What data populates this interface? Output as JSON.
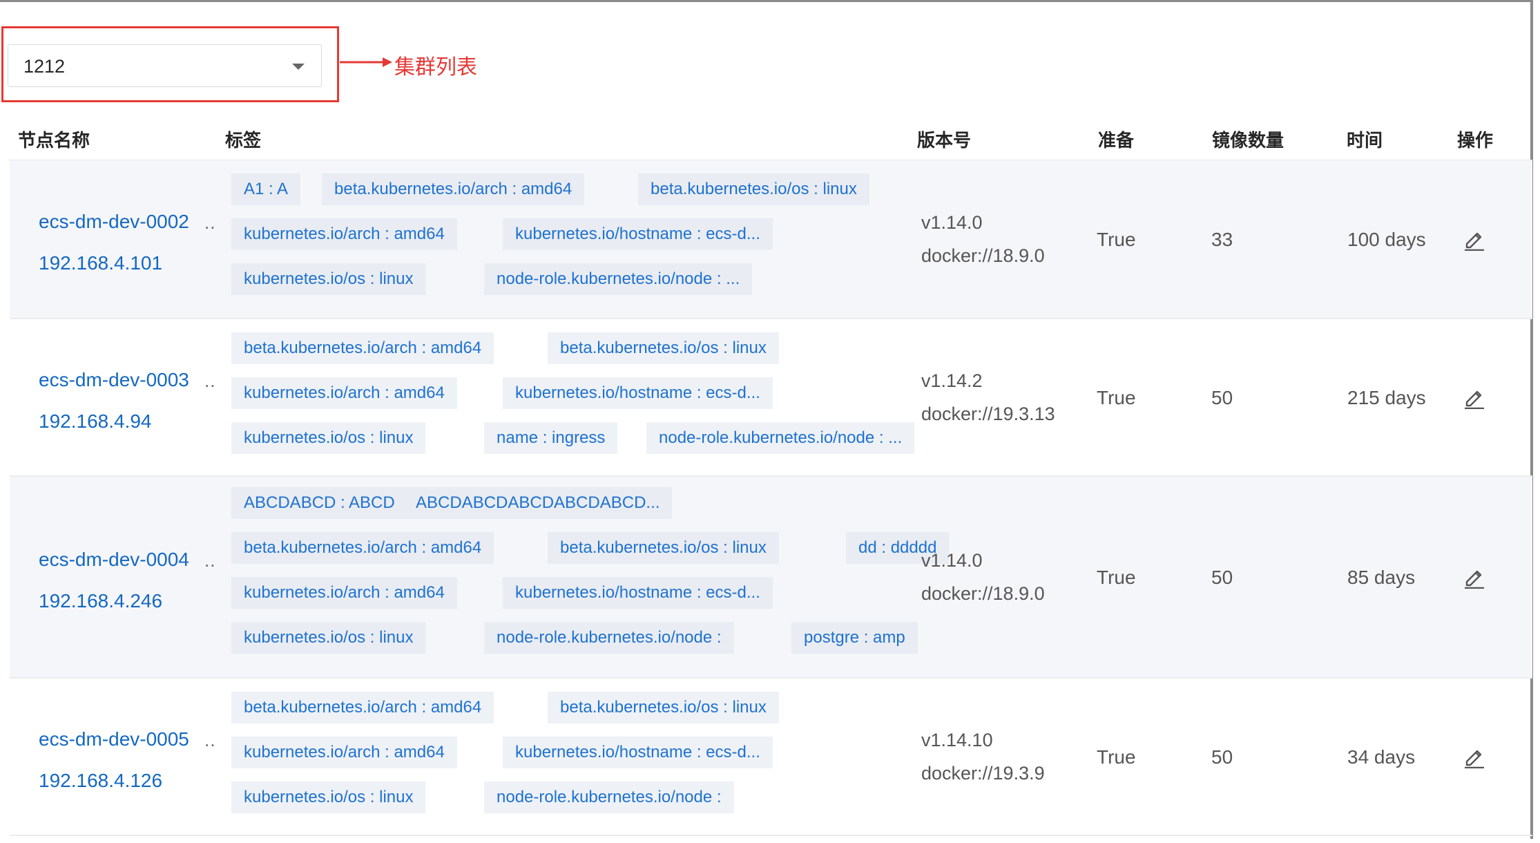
{
  "cluster_select": {
    "value": "1212"
  },
  "annotation": {
    "label": "集群列表"
  },
  "columns": [
    "节点名称",
    "标签",
    "版本号",
    "准备",
    "镜像数量",
    "时间",
    "操作"
  ],
  "rows": [
    {
      "name": "ecs-dm-dev-0002",
      "ip": "192.168.4.101",
      "dots": "..",
      "tags": [
        [
          "A1 : A",
          "beta.kubernetes.io/arch : amd64",
          "beta.kubernetes.io/os : linux"
        ],
        [
          "kubernetes.io/arch : amd64",
          "kubernetes.io/hostname : ecs-d..."
        ],
        [
          "kubernetes.io/os : linux",
          "node-role.kubernetes.io/node : ..."
        ]
      ],
      "version": "v1.14.0",
      "docker": "docker://18.9.0",
      "ready": "True",
      "images": "33",
      "time": "100 days",
      "action_icon": "edit-icon"
    },
    {
      "name": "ecs-dm-dev-0003",
      "ip": "192.168.4.94",
      "dots": "..",
      "tags": [
        [
          "beta.kubernetes.io/arch : amd64",
          "beta.kubernetes.io/os : linux"
        ],
        [
          "kubernetes.io/arch : amd64",
          "kubernetes.io/hostname : ecs-d..."
        ],
        [
          "kubernetes.io/os : linux",
          "name : ingress",
          "node-role.kubernetes.io/node : ..."
        ]
      ],
      "version": "v1.14.2",
      "docker": "docker://19.3.13",
      "ready": "True",
      "images": "50",
      "time": "215 days",
      "action_icon": "edit-icon"
    },
    {
      "name": "ecs-dm-dev-0004",
      "ip": "192.168.4.246",
      "dots": "..",
      "tags": [
        [
          "ABCDABCD : ABCD",
          "ABCDABCDABCDABCDABCD..."
        ],
        [
          "beta.kubernetes.io/arch : amd64",
          "beta.kubernetes.io/os : linux",
          "dd : ddddd"
        ],
        [
          "kubernetes.io/arch : amd64",
          "kubernetes.io/hostname : ecs-d..."
        ],
        [
          "kubernetes.io/os : linux",
          "node-role.kubernetes.io/node :",
          "postgre : amp"
        ]
      ],
      "version": "v1.14.0",
      "docker": "docker://18.9.0",
      "ready": "True",
      "images": "50",
      "time": "85 days",
      "action_icon": "edit-icon"
    },
    {
      "name": "ecs-dm-dev-0005",
      "ip": "192.168.4.126",
      "dots": "..",
      "tags": [
        [
          "beta.kubernetes.io/arch : amd64",
          "beta.kubernetes.io/os : linux"
        ],
        [
          "kubernetes.io/arch : amd64",
          "kubernetes.io/hostname : ecs-d..."
        ],
        [
          "kubernetes.io/os : linux",
          "node-role.kubernetes.io/node :"
        ]
      ],
      "version": "v1.14.10",
      "docker": "docker://19.3.9",
      "ready": "True",
      "images": "50",
      "time": "34 days",
      "action_icon": "edit-icon"
    }
  ]
}
